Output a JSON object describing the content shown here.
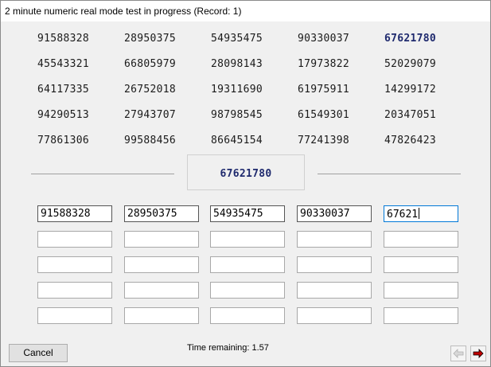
{
  "window": {
    "title": "2 minute numeric real mode test in progress (Record: 1)"
  },
  "grid": {
    "rows": [
      [
        "91588328",
        "28950375",
        "54935475",
        "90330037",
        "67621780"
      ],
      [
        "45543321",
        "66805979",
        "28098143",
        "17973822",
        "52029079"
      ],
      [
        "64117335",
        "26752018",
        "19311690",
        "61975911",
        "14299172"
      ],
      [
        "94290513",
        "27943707",
        "98798545",
        "61549301",
        "20347051"
      ],
      [
        "77861306",
        "99588456",
        "86645154",
        "77241398",
        "47826423"
      ]
    ],
    "highlighted": "67621780"
  },
  "current_number": "67621780",
  "entries": [
    [
      "91588328",
      "28950375",
      "54935475",
      "90330037",
      "67621"
    ],
    [
      "",
      "",
      "",
      "",
      ""
    ],
    [
      "",
      "",
      "",
      "",
      ""
    ],
    [
      "",
      "",
      "",
      "",
      ""
    ],
    [
      "",
      "",
      "",
      "",
      ""
    ]
  ],
  "footer": {
    "cancel_label": "Cancel",
    "time_remaining": "Time remaining: 1.57"
  },
  "icons": {
    "back": "arrow-left-icon",
    "next": "arrow-right-icon"
  },
  "colors": {
    "highlight": "#1f2a6e",
    "next_arrow": "#c00000",
    "focus_border": "#0078d7"
  }
}
